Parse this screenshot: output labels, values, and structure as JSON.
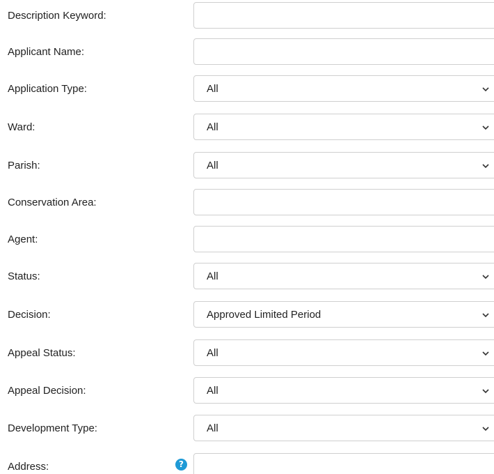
{
  "form": {
    "description_keyword": {
      "label": "Description Keyword:",
      "value": "",
      "placeholder": ""
    },
    "applicant_name": {
      "label": "Applicant Name:",
      "value": "",
      "placeholder": ""
    },
    "application_type": {
      "label": "Application Type:",
      "selected": "All"
    },
    "ward": {
      "label": "Ward:",
      "selected": "All"
    },
    "parish": {
      "label": "Parish:",
      "selected": "All"
    },
    "conservation_area": {
      "label": "Conservation Area:",
      "value": "",
      "placeholder": ""
    },
    "agent": {
      "label": "Agent:",
      "value": "",
      "placeholder": ""
    },
    "status": {
      "label": "Status:",
      "selected": "All"
    },
    "decision": {
      "label": "Decision:",
      "selected": "Approved Limited Period"
    },
    "appeal_status": {
      "label": "Appeal Status:",
      "selected": "All"
    },
    "appeal_decision": {
      "label": "Appeal Decision:",
      "selected": "All"
    },
    "development_type": {
      "label": "Development Type:",
      "selected": "All"
    },
    "address": {
      "label": "Address:",
      "value": "",
      "placeholder": "",
      "help_icon": "?"
    }
  },
  "icons": {
    "dropdown": "chevron-down-icon",
    "help": "help-icon"
  },
  "colors": {
    "help_icon_bg": "#1f9ad6",
    "border": "#cfcfcf"
  }
}
